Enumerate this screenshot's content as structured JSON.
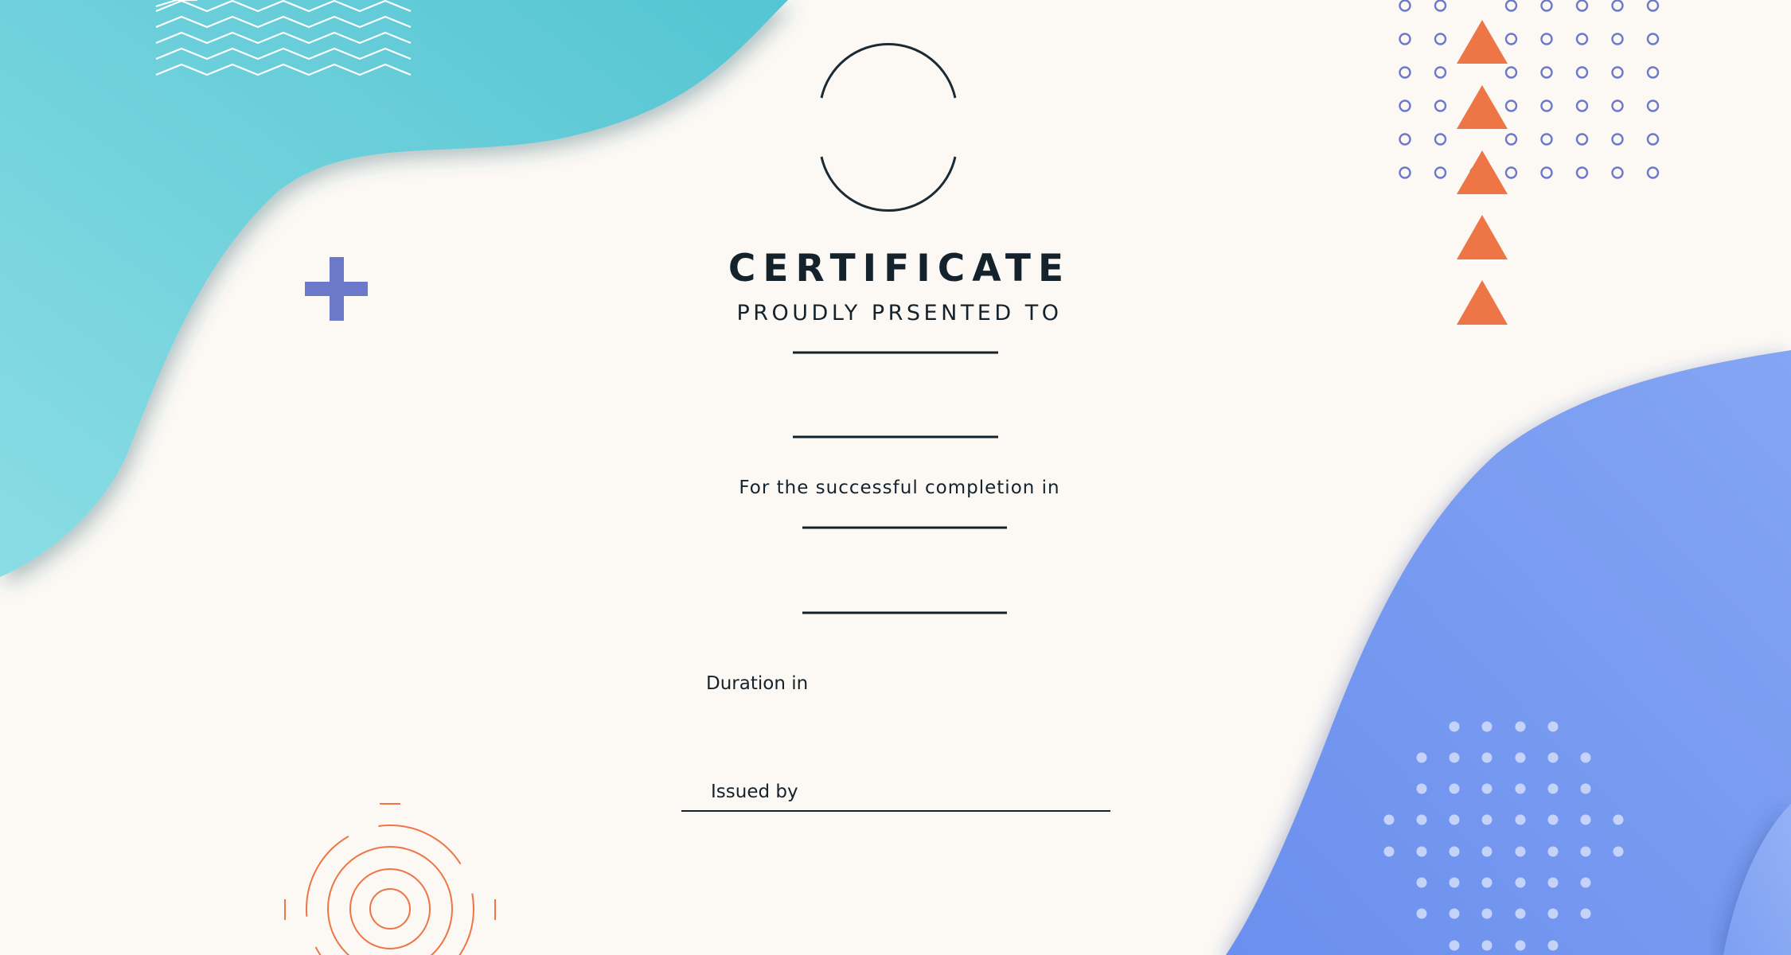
{
  "certificate": {
    "title": "CERTIFICATE",
    "subtitle": "PROUDLY PRSENTED TO",
    "completion_text": "For the successful completion in",
    "duration_label": "Duration in",
    "issued_by_label": "Issued by"
  },
  "colors": {
    "background": "#fcf9f5",
    "teal_accent": "#6fd0da",
    "blue_accent": "#7399ef",
    "orange_accent": "#ee7546",
    "indigo_accent": "#6c78c9",
    "ink": "#14222b"
  },
  "icons": [
    "zigzag-pattern",
    "arc-emblem",
    "plus-icon",
    "ring-grid",
    "triangle-column",
    "target-circles",
    "dot-grid"
  ]
}
